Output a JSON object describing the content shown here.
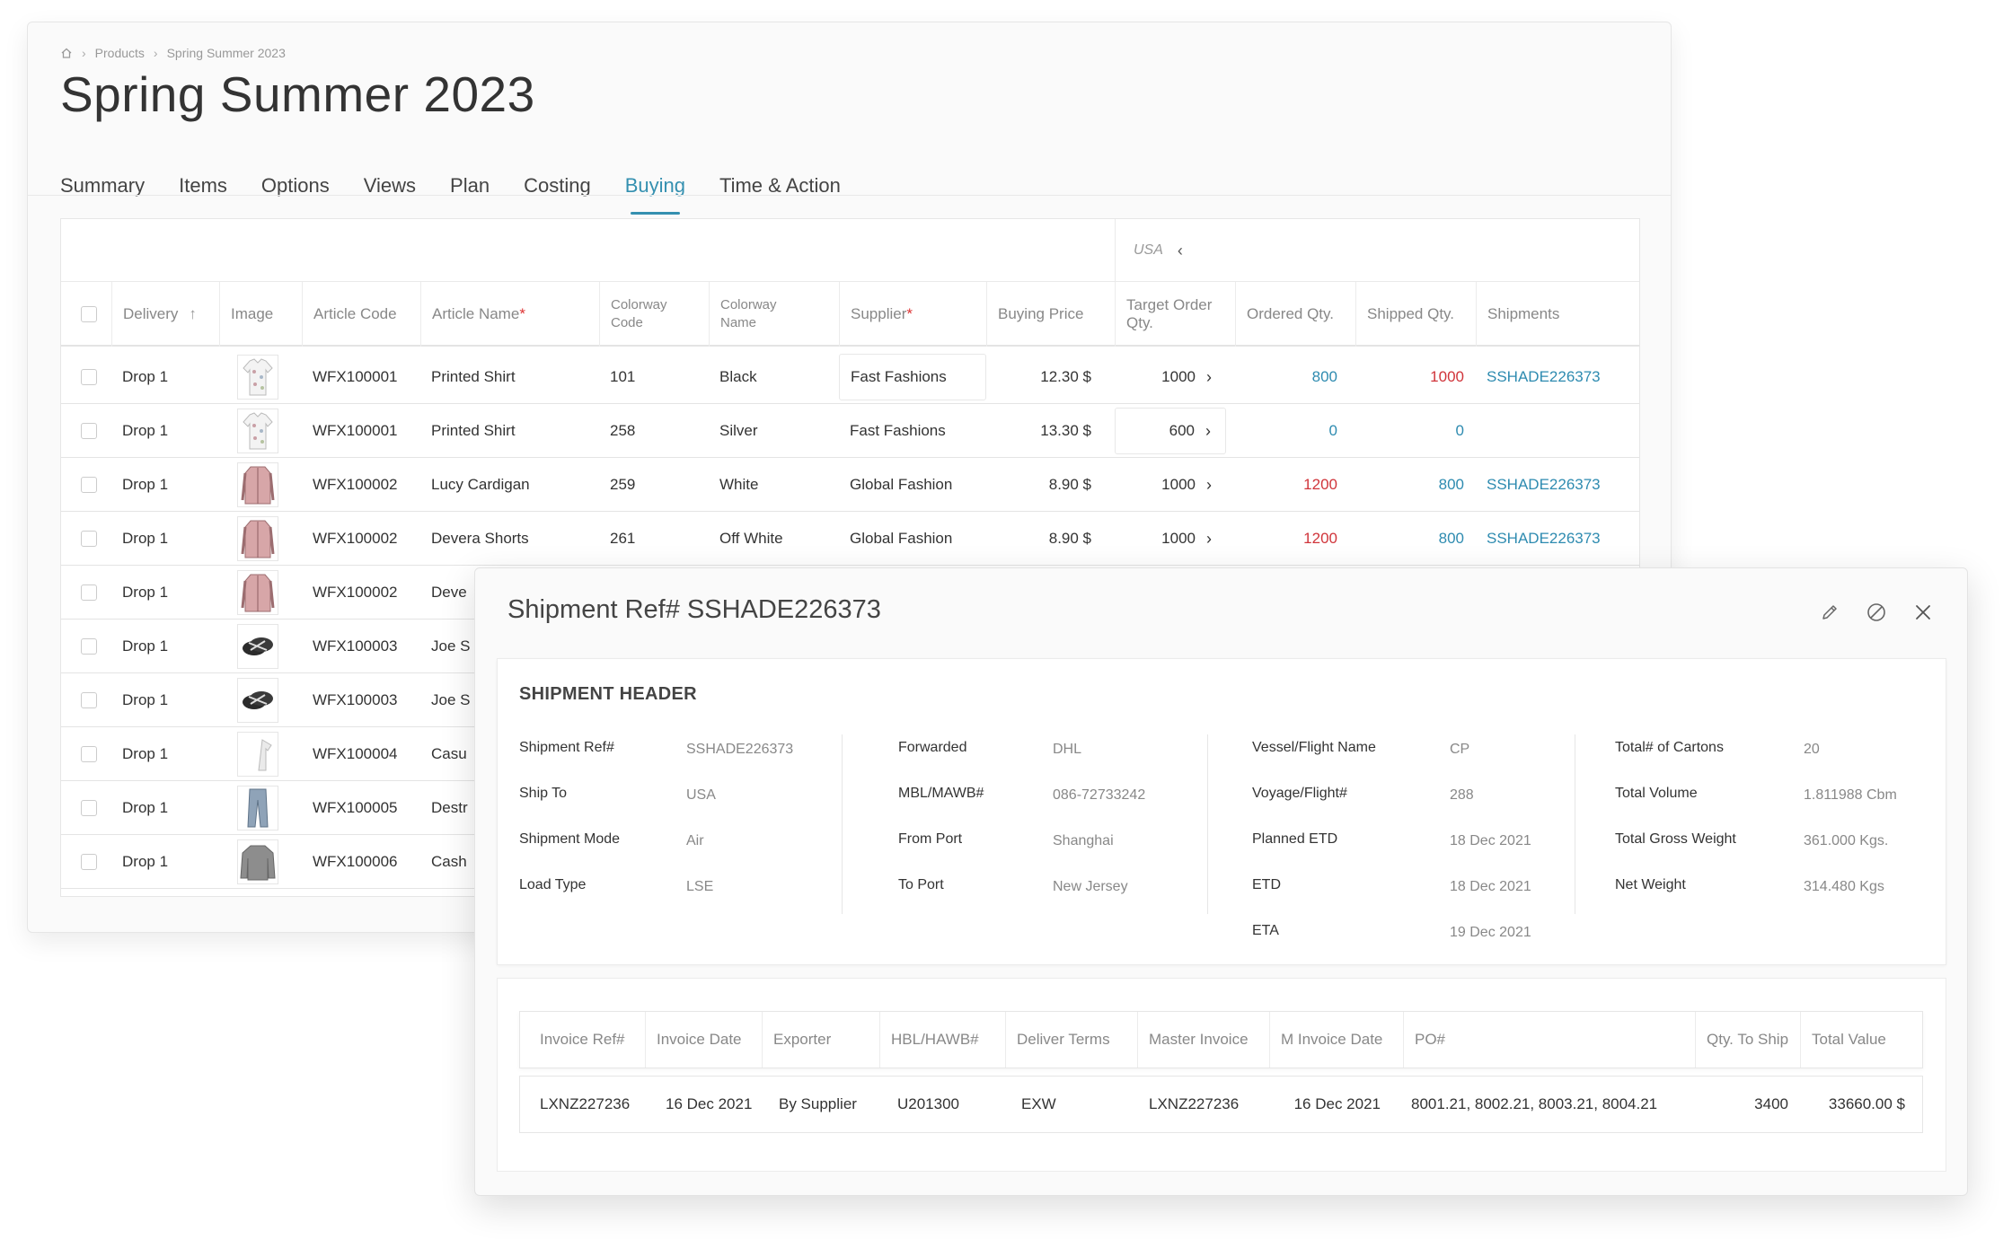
{
  "breadcrumb": {
    "items": [
      "Products",
      "Spring Summer 2023"
    ],
    "separator": "›"
  },
  "page": {
    "title": "Spring Summer 2023"
  },
  "tabs": [
    {
      "label": "Summary",
      "active": false
    },
    {
      "label": "Items",
      "active": false
    },
    {
      "label": "Options",
      "active": false
    },
    {
      "label": "Views",
      "active": false
    },
    {
      "label": "Plan",
      "active": false
    },
    {
      "label": "Costing",
      "active": false
    },
    {
      "label": "Buying",
      "active": true
    },
    {
      "label": "Time & Action",
      "active": false
    }
  ],
  "grid": {
    "group_label": "USA",
    "group_chevron": "‹",
    "columns": {
      "delivery": "Delivery",
      "sort_arrow": "↑",
      "image": "Image",
      "article_code": "Article Code",
      "article_name": "Article Name",
      "required_mark": "*",
      "colorway_code_1": "Colorway",
      "colorway_code_2": "Code",
      "colorway_name_1": "Colorway",
      "colorway_name_2": "Name",
      "supplier": "Supplier",
      "buying_price": "Buying Price",
      "target_qty_1": "Target Order",
      "target_qty_2": "Qty.",
      "ordered_qty": "Ordered Qty.",
      "shipped_qty": "Shipped Qty.",
      "shipments": "Shipments"
    },
    "rows": [
      {
        "delivery": "Drop 1",
        "image": "shirt",
        "code": "WFX100001",
        "name": "Printed Shirt",
        "cw_code": "101",
        "cw_name": "Black",
        "supplier": "Fast Fashions",
        "price": "12.30 $",
        "target": "1000",
        "ordered": "800",
        "shipped": "1000",
        "shipment": "SSHADE226373"
      },
      {
        "delivery": "Drop 1",
        "image": "shirt",
        "code": "WFX100001",
        "name": "Printed Shirt",
        "cw_code": "258",
        "cw_name": "Silver",
        "supplier": "Fast Fashions",
        "price": "13.30 $",
        "target": "600",
        "ordered": "0",
        "shipped": "0",
        "shipment": ""
      },
      {
        "delivery": "Drop 1",
        "image": "cardigan",
        "code": "WFX100002",
        "name": "Lucy Cardigan",
        "cw_code": "259",
        "cw_name": "White",
        "supplier": "Global Fashion",
        "price": "8.90 $",
        "target": "1000",
        "ordered": "1200",
        "shipped": "800",
        "shipment": "SSHADE226373"
      },
      {
        "delivery": "Drop 1",
        "image": "cardigan",
        "code": "WFX100002",
        "name": "Devera Shorts",
        "cw_code": "261",
        "cw_name": "Off White",
        "supplier": "Global Fashion",
        "price": "8.90 $",
        "target": "1000",
        "ordered": "1200",
        "shipped": "800",
        "shipment": "SSHADE226373"
      },
      {
        "delivery": "Drop 1",
        "image": "cardigan",
        "code": "WFX100002",
        "name": "Deve"
      },
      {
        "delivery": "Drop 1",
        "image": "sandal",
        "code": "WFX100003",
        "name": "Joe S"
      },
      {
        "delivery": "Drop 1",
        "image": "sandal",
        "code": "WFX100003",
        "name": "Joe S"
      },
      {
        "delivery": "Drop 1",
        "image": "tshirt",
        "code": "WFX100004",
        "name": "Casu"
      },
      {
        "delivery": "Drop 1",
        "image": "jeans",
        "code": "WFX100005",
        "name": "Destr"
      },
      {
        "delivery": "Drop 1",
        "image": "sweater",
        "code": "WFX100006",
        "name": "Cash"
      }
    ]
  },
  "panel": {
    "title": "Shipment Ref# SSHADE226373",
    "actions": [
      "pencil-icon",
      "cancel-icon",
      "close-icon"
    ],
    "header": {
      "heading": "SHIPMENT HEADER",
      "col1": [
        {
          "label": "Shipment Ref#",
          "value": "SSHADE226373"
        },
        {
          "label": "Ship To",
          "value": "USA"
        },
        {
          "label": "Shipment Mode",
          "value": "Air"
        },
        {
          "label": "Load Type",
          "value": "LSE"
        }
      ],
      "col2": [
        {
          "label": "Forwarded",
          "value": "DHL"
        },
        {
          "label": "MBL/MAWB#",
          "value": "086-72733242"
        },
        {
          "label": "From Port",
          "value": "Shanghai"
        },
        {
          "label": "To Port",
          "value": "New Jersey"
        }
      ],
      "col3": [
        {
          "label": "Vessel/Flight Name",
          "value": "CP"
        },
        {
          "label": "Voyage/Flight#",
          "value": "288"
        },
        {
          "label": "Planned ETD",
          "value": "18 Dec 2021"
        },
        {
          "label": "ETD",
          "value": "18 Dec 2021"
        },
        {
          "label": "ETA",
          "value": "19 Dec 2021"
        }
      ],
      "col4": [
        {
          "label": "Total# of Cartons",
          "value": "20"
        },
        {
          "label": "Total Volume",
          "value": "1.811988 Cbm"
        },
        {
          "label": "Total Gross Weight",
          "value": "361.000 Kgs."
        },
        {
          "label": "Net Weight",
          "value": "314.480 Kgs"
        }
      ]
    },
    "invoice": {
      "columns": [
        "Invoice Ref#",
        "Invoice Date",
        "Exporter",
        "HBL/HAWB#",
        "Deliver Terms",
        "Master Invoice",
        "M Invoice Date",
        "PO#",
        "Qty. To Ship",
        "Total Value"
      ],
      "row": [
        "LXNZ227236",
        "16 Dec 2021",
        "By Supplier",
        "U201300",
        "EXW",
        "LXNZ227236",
        "16 Dec 2021",
        "8001.21, 8002.21, 8003.21, 8004.21",
        "3400",
        "33660.00 $"
      ]
    }
  },
  "colors": {
    "accent": "#3490b0",
    "link": "#2e8bb0",
    "negative": "#d0343a"
  }
}
